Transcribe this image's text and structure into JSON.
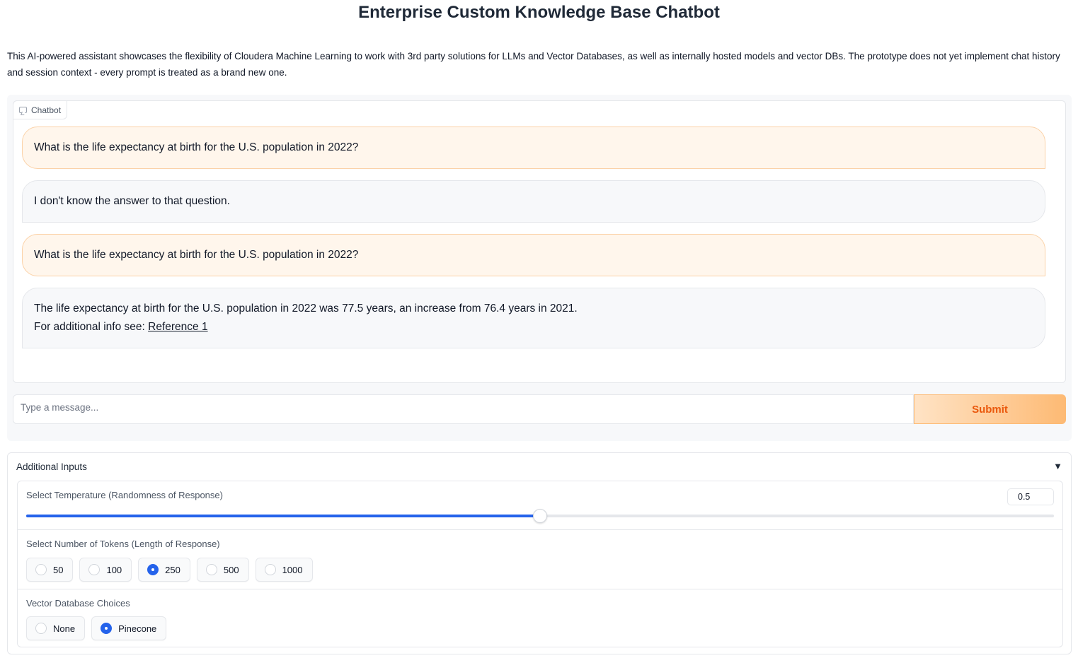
{
  "header": {
    "title": "Enterprise Custom Knowledge Base Chatbot",
    "description": "This AI-powered assistant showcases the flexibility of Cloudera Machine Learning to work with 3rd party solutions for LLMs and Vector Databases, as well as internally hosted models and vector DBs. The prototype does not yet implement chat history and session context - every prompt is treated as a brand new one."
  },
  "chatbot": {
    "label": "Chatbot",
    "messages": [
      {
        "role": "user",
        "text": "What is the life expectancy at birth for the U.S. population in 2022?"
      },
      {
        "role": "bot",
        "text": "I don't know the answer to that question."
      },
      {
        "role": "user",
        "text": "What is the life expectancy at birth for the U.S. population in 2022?"
      },
      {
        "role": "bot",
        "text": "The life expectancy at birth for the U.S. population in 2022 was 77.5 years, an increase from 76.4 years in 2021.",
        "ref_prefix": "For additional info see: ",
        "ref_link": "Reference 1"
      }
    ]
  },
  "composer": {
    "placeholder": "Type a message...",
    "value": "",
    "submit_label": "Submit"
  },
  "additional_inputs": {
    "title": "Additional Inputs",
    "caret": "▼",
    "temperature": {
      "label": "Select Temperature (Randomness of Response)",
      "value": "0.5",
      "min": 0,
      "max": 1,
      "level": 0.5
    },
    "tokens": {
      "label": "Select Number of Tokens (Length of Response)",
      "options": [
        "50",
        "100",
        "250",
        "500",
        "1000"
      ],
      "selected": "250"
    },
    "vector_db": {
      "label": "Vector Database Choices",
      "options": [
        "None",
        "Pinecone"
      ],
      "selected": "Pinecone"
    }
  },
  "colors": {
    "accent_blue": "#2563eb",
    "submit_text": "#ea580c",
    "user_bubble": "#fff6ec",
    "bot_bubble": "#f7f8fa"
  }
}
